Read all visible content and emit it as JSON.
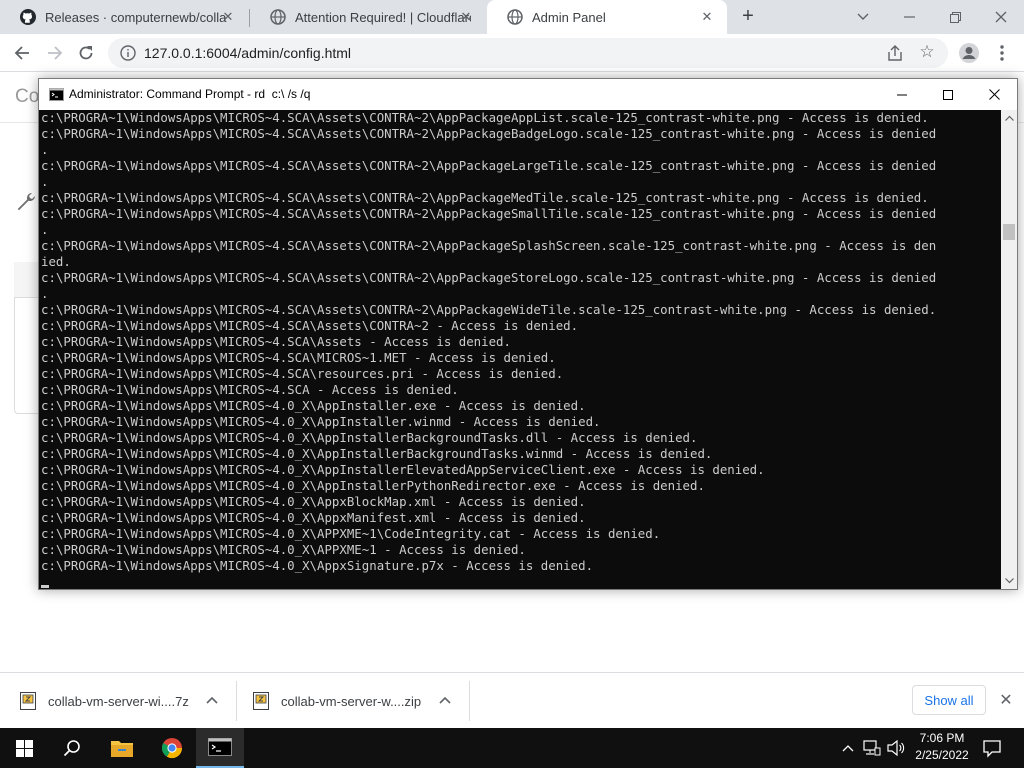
{
  "browser": {
    "tabs": [
      {
        "title": "Releases · computernewb/collab",
        "icon": "github-icon",
        "active": false
      },
      {
        "title": "Attention Required! | Cloudflare",
        "icon": "globe-icon",
        "active": false
      },
      {
        "title": "Admin Panel",
        "icon": "globe-icon",
        "active": true
      }
    ],
    "url": "127.0.0.1:6004/admin/config.html"
  },
  "page": {
    "heading": "Co"
  },
  "cmd": {
    "title": "Administrator: Command Prompt - rd  c:\\ /s /q",
    "lines": [
      "c:\\PROGRA~1\\WindowsApps\\MICROS~4.SCA\\Assets\\CONTRA~2\\AppPackageAppList.scale-125_contrast-white.png - Access is denied.",
      "c:\\PROGRA~1\\WindowsApps\\MICROS~4.SCA\\Assets\\CONTRA~2\\AppPackageBadgeLogo.scale-125_contrast-white.png - Access is denied",
      ".",
      "c:\\PROGRA~1\\WindowsApps\\MICROS~4.SCA\\Assets\\CONTRA~2\\AppPackageLargeTile.scale-125_contrast-white.png - Access is denied",
      ".",
      "c:\\PROGRA~1\\WindowsApps\\MICROS~4.SCA\\Assets\\CONTRA~2\\AppPackageMedTile.scale-125_contrast-white.png - Access is denied.",
      "c:\\PROGRA~1\\WindowsApps\\MICROS~4.SCA\\Assets\\CONTRA~2\\AppPackageSmallTile.scale-125_contrast-white.png - Access is denied",
      ".",
      "c:\\PROGRA~1\\WindowsApps\\MICROS~4.SCA\\Assets\\CONTRA~2\\AppPackageSplashScreen.scale-125_contrast-white.png - Access is den",
      "ied.",
      "c:\\PROGRA~1\\WindowsApps\\MICROS~4.SCA\\Assets\\CONTRA~2\\AppPackageStoreLogo.scale-125_contrast-white.png - Access is denied",
      ".",
      "c:\\PROGRA~1\\WindowsApps\\MICROS~4.SCA\\Assets\\CONTRA~2\\AppPackageWideTile.scale-125_contrast-white.png - Access is denied.",
      "c:\\PROGRA~1\\WindowsApps\\MICROS~4.SCA\\Assets\\CONTRA~2 - Access is denied.",
      "c:\\PROGRA~1\\WindowsApps\\MICROS~4.SCA\\Assets - Access is denied.",
      "c:\\PROGRA~1\\WindowsApps\\MICROS~4.SCA\\MICROS~1.MET - Access is denied.",
      "c:\\PROGRA~1\\WindowsApps\\MICROS~4.SCA\\resources.pri - Access is denied.",
      "c:\\PROGRA~1\\WindowsApps\\MICROS~4.SCA - Access is denied.",
      "c:\\PROGRA~1\\WindowsApps\\MICROS~4.0_X\\AppInstaller.exe - Access is denied.",
      "c:\\PROGRA~1\\WindowsApps\\MICROS~4.0_X\\AppInstaller.winmd - Access is denied.",
      "c:\\PROGRA~1\\WindowsApps\\MICROS~4.0_X\\AppInstallerBackgroundTasks.dll - Access is denied.",
      "c:\\PROGRA~1\\WindowsApps\\MICROS~4.0_X\\AppInstallerBackgroundTasks.winmd - Access is denied.",
      "c:\\PROGRA~1\\WindowsApps\\MICROS~4.0_X\\AppInstallerElevatedAppServiceClient.exe - Access is denied.",
      "c:\\PROGRA~1\\WindowsApps\\MICROS~4.0_X\\AppInstallerPythonRedirector.exe - Access is denied.",
      "c:\\PROGRA~1\\WindowsApps\\MICROS~4.0_X\\AppxBlockMap.xml - Access is denied.",
      "c:\\PROGRA~1\\WindowsApps\\MICROS~4.0_X\\AppxManifest.xml - Access is denied.",
      "c:\\PROGRA~1\\WindowsApps\\MICROS~4.0_X\\APPXME~1\\CodeIntegrity.cat - Access is denied.",
      "c:\\PROGRA~1\\WindowsApps\\MICROS~4.0_X\\APPXME~1 - Access is denied.",
      "c:\\PROGRA~1\\WindowsApps\\MICROS~4.0_X\\AppxSignature.p7x - Access is denied."
    ]
  },
  "downloads": {
    "items": [
      {
        "name": "collab-vm-server-wi....7z"
      },
      {
        "name": "collab-vm-server-w....zip"
      }
    ],
    "show_all": "Show all"
  },
  "taskbar": {
    "time": "7:06 PM",
    "date": "2/25/2022",
    "pinned": [
      "windows-start-icon",
      "search-icon",
      "file-explorer-icon",
      "chrome-icon",
      "command-prompt-icon"
    ]
  },
  "colors": {
    "console_bg": "#0c0c0c",
    "console_fg": "#cccccc",
    "taskbar_bg": "#101010",
    "link_blue": "#1a73e8"
  }
}
